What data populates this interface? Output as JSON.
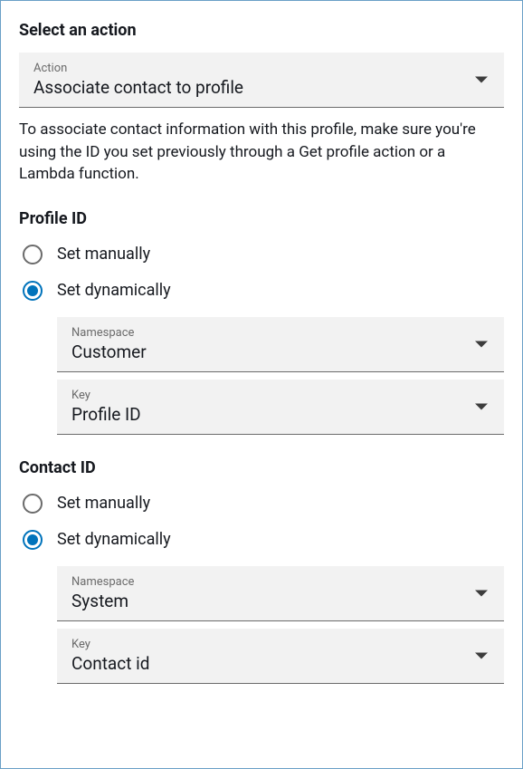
{
  "header": {
    "title": "Select an action"
  },
  "actionSelect": {
    "label": "Action",
    "value": "Associate contact to profile"
  },
  "description": "To associate contact information with this profile, make sure you're using the ID you set previously through a Get profile action or a Lambda function.",
  "profileId": {
    "title": "Profile ID",
    "options": {
      "manual": "Set manually",
      "dynamic": "Set dynamically"
    },
    "namespace": {
      "label": "Namespace",
      "value": "Customer"
    },
    "key": {
      "label": "Key",
      "value": "Profile ID"
    }
  },
  "contactId": {
    "title": "Contact ID",
    "options": {
      "manual": "Set manually",
      "dynamic": "Set dynamically"
    },
    "namespace": {
      "label": "Namespace",
      "value": "System"
    },
    "key": {
      "label": "Key",
      "value": "Contact id"
    }
  }
}
